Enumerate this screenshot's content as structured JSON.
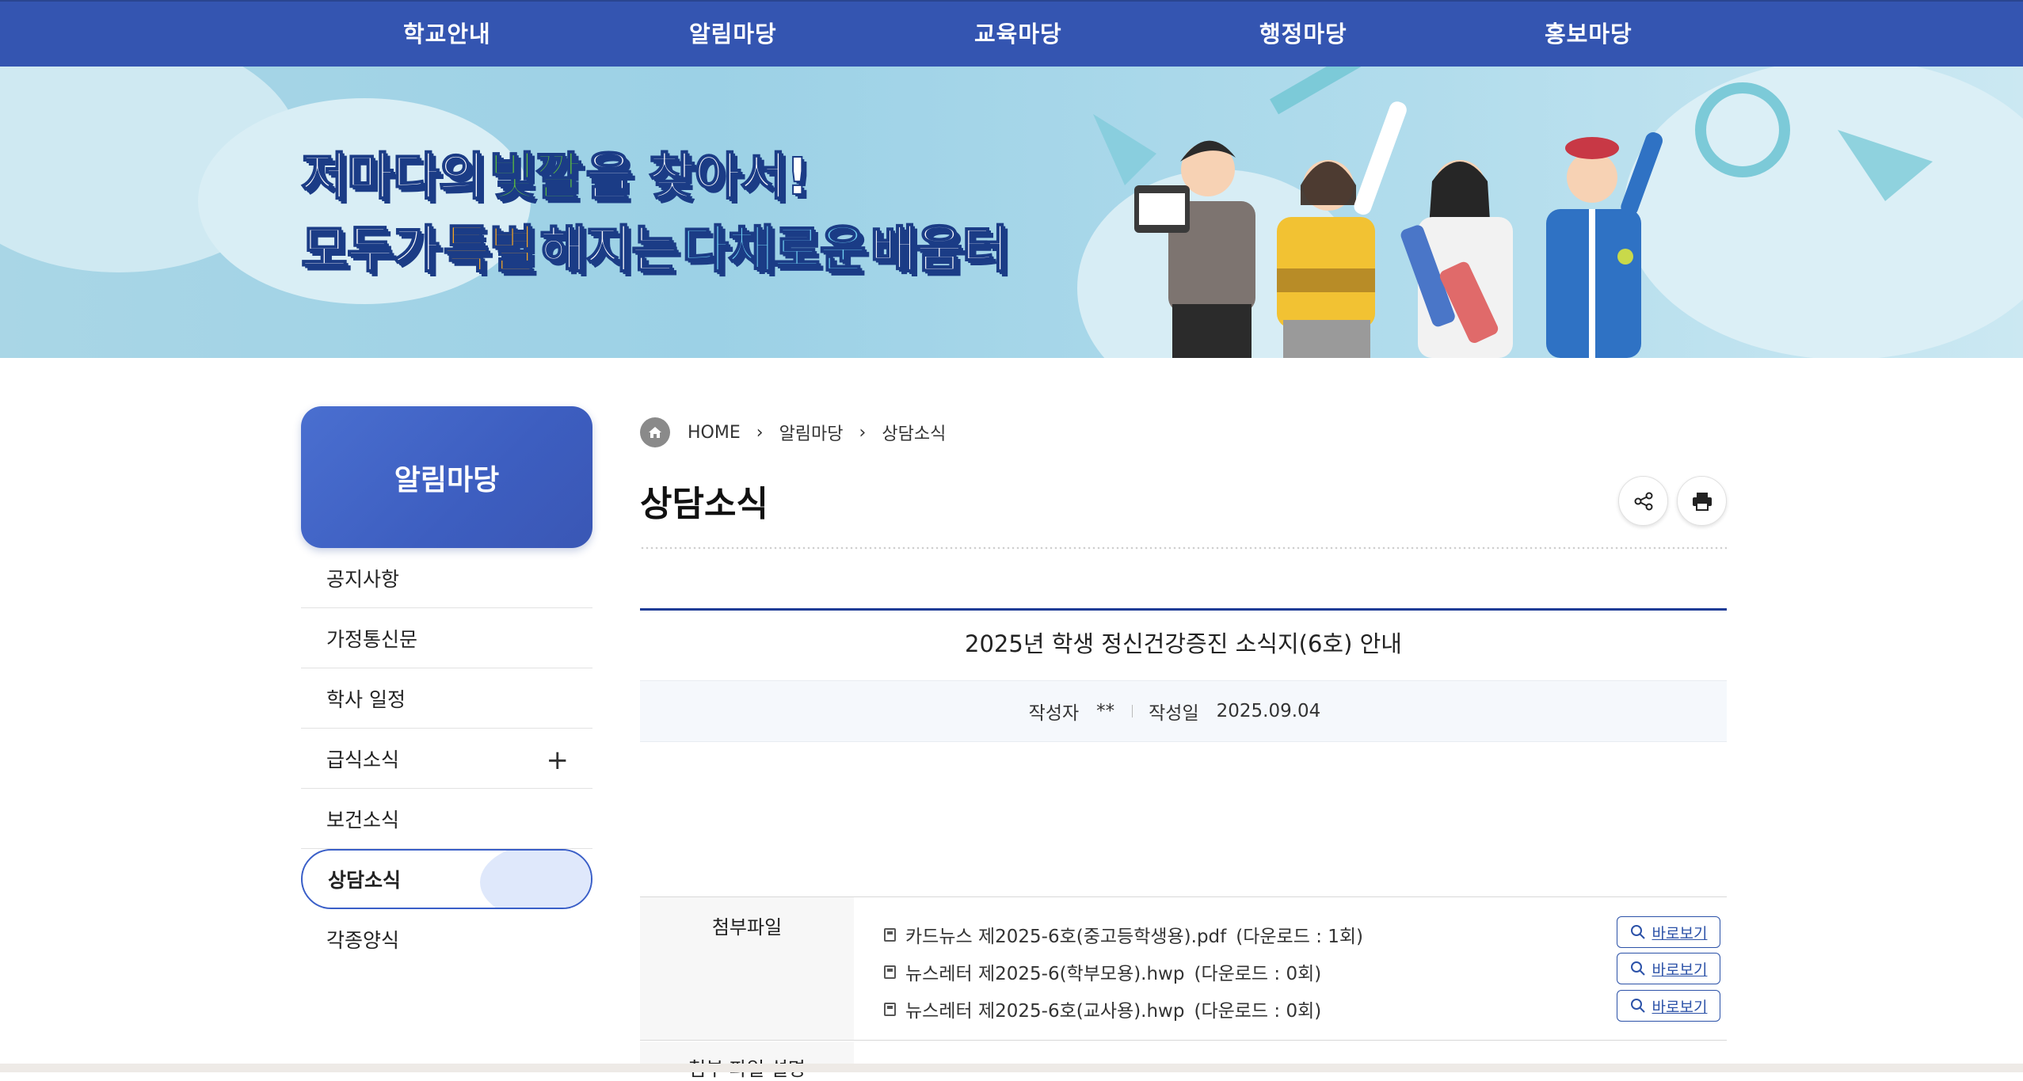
{
  "topnav": {
    "items": [
      "학교안내",
      "알림마당",
      "교육마당",
      "행정마당",
      "홍보마당"
    ],
    "bg_color": "#3455b1"
  },
  "banner": {
    "line1_a": "저마다의",
    "line1_hl": "빛깔",
    "line1_b": "을 찾아서!",
    "line2_a": "모두가",
    "line2_hl1": "특별",
    "line2_b": "해지는",
    "line2_hl2": "다채로운",
    "line2_c": "배움터"
  },
  "sidebar": {
    "title": "알림마당",
    "items": [
      {
        "label": "공지사항"
      },
      {
        "label": "가정통신문"
      },
      {
        "label": "학사 일정"
      },
      {
        "label": "급식소식",
        "expandable": true
      },
      {
        "label": "보건소식"
      },
      {
        "label": "상담소식",
        "active": true
      },
      {
        "label": "각종양식"
      }
    ],
    "expand_glyph": "+"
  },
  "breadcrumb": {
    "home_icon": "home-icon",
    "items": [
      "HOME",
      "알림마당",
      "상담소식"
    ],
    "separator": "›"
  },
  "page": {
    "title": "상담소식",
    "share_icon": "share-icon",
    "print_icon": "print-icon"
  },
  "article": {
    "title": "2025년 학생 정신건강증진 소식지(6호) 안내",
    "author_label": "작성자",
    "author_value": "**",
    "date_label": "작성일",
    "date_value": "2025.09.04"
  },
  "attachments": {
    "label": "첨부파일",
    "files": [
      {
        "name": "카드뉴스 제2025-6호(중고등학생용).pdf",
        "downloads": "(다운로드 : 1회)",
        "button": "바로보기"
      },
      {
        "name": "뉴스레터 제2025-6(학부모용).hwp",
        "downloads": "(다운로드 : 0회)",
        "button": "바로보기"
      },
      {
        "name": "뉴스레터 제2025-6호(교사용).hwp",
        "downloads": "(다운로드 : 0회)",
        "button": "바로보기"
      }
    ],
    "desc_label": "첨부 파일 설명"
  },
  "colors": {
    "accent": "#3455b1",
    "article_rule": "#1e3c96",
    "slogan_green": "#5fc23b",
    "slogan_orange": "#f5a623",
    "slogan_cyan": "#6fd0f2"
  }
}
